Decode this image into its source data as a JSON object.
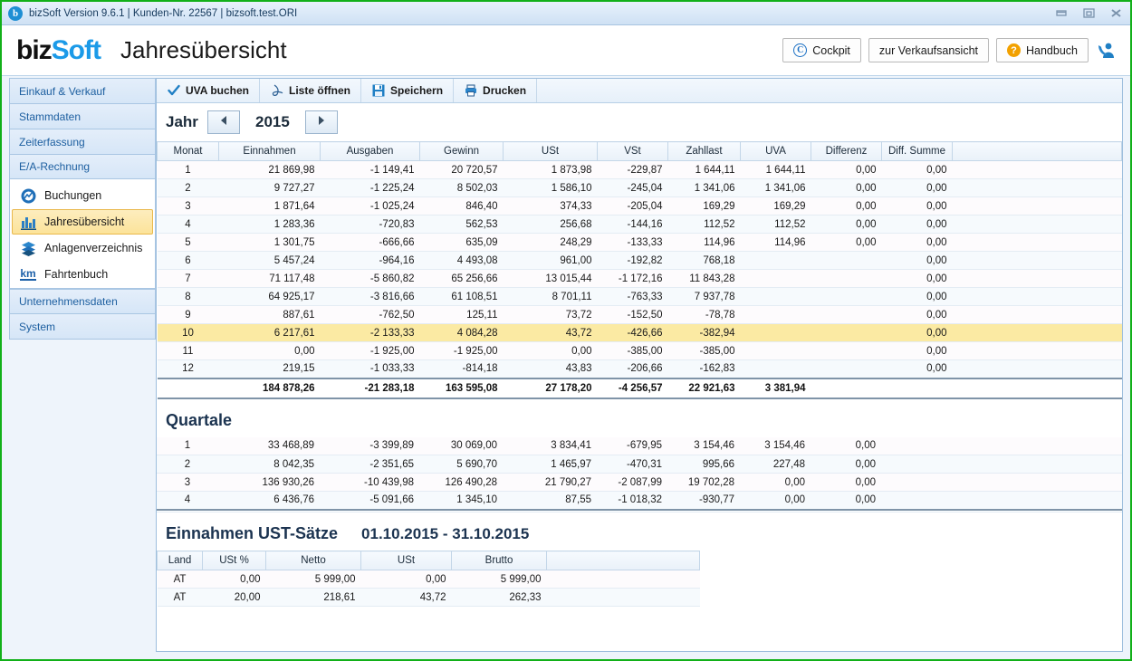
{
  "window": {
    "title": "bizSoft Version 9.6.1 | Kunden-Nr. 22567 | bizsoft.test.ORI",
    "app_icon": "b-circle-icon",
    "controls": [
      "minimize-icon",
      "restore-icon",
      "close-icon"
    ]
  },
  "header": {
    "logo_biz": "biz",
    "logo_soft": "Soft",
    "page_title": "Jahresübersicht",
    "buttons": [
      {
        "label": "Cockpit",
        "icon": "copyright-icon"
      },
      {
        "label": "zur Verkaufsansicht",
        "icon": ""
      },
      {
        "label": "Handbuch",
        "icon": "question-icon"
      }
    ],
    "support_icon": "support-contact-icon"
  },
  "sidebar": {
    "sections": [
      {
        "label": "Einkauf & Verkauf"
      },
      {
        "label": "Stammdaten"
      },
      {
        "label": "Zeiterfassung"
      },
      {
        "label": "E/A-Rechnung"
      }
    ],
    "items": [
      {
        "label": "Buchungen",
        "icon": "chart-circle-icon",
        "active": false
      },
      {
        "label": "Jahresübersicht",
        "icon": "bar-chart-icon",
        "active": true
      },
      {
        "label": "Anlagenverzeichnis",
        "icon": "layers-icon",
        "active": false
      },
      {
        "label": "Fahrtenbuch",
        "icon": "km-icon",
        "active": false
      }
    ],
    "bottom_sections": [
      {
        "label": "Unternehmensdaten"
      },
      {
        "label": "System"
      }
    ]
  },
  "toolbar": {
    "buttons": [
      {
        "label": "UVA buchen",
        "icon": "check-icon"
      },
      {
        "label": "Liste öffnen",
        "icon": "pdf-icon"
      },
      {
        "label": "Speichern",
        "icon": "save-disk-icon"
      },
      {
        "label": "Drucken",
        "icon": "printer-icon"
      }
    ]
  },
  "year_nav": {
    "label": "Jahr",
    "prev_icon": "triangle-left-icon",
    "next_icon": "triangle-right-icon",
    "value": "2015"
  },
  "chart_data": {
    "type": "table",
    "title": "Jahresübersicht 2015",
    "columns": [
      "Monat",
      "Einnahmen",
      "Ausgaben",
      "Gewinn",
      "USt",
      "VSt",
      "Zahllast",
      "UVA",
      "Differenz",
      "Diff. Summe"
    ],
    "monthly_rows": [
      {
        "monat": "1",
        "einnahmen": "21 869,98",
        "ausgaben": "-1 149,41",
        "gewinn": "20 720,57",
        "ust": "1 873,98",
        "vst": "-229,87",
        "zahllast": "1 644,11",
        "uva": "1 644,11",
        "differenz": "0,00",
        "diff_summe": "0,00",
        "highlight": false
      },
      {
        "monat": "2",
        "einnahmen": "9 727,27",
        "ausgaben": "-1 225,24",
        "gewinn": "8 502,03",
        "ust": "1 586,10",
        "vst": "-245,04",
        "zahllast": "1 341,06",
        "uva": "1 341,06",
        "differenz": "0,00",
        "diff_summe": "0,00",
        "highlight": false
      },
      {
        "monat": "3",
        "einnahmen": "1 871,64",
        "ausgaben": "-1 025,24",
        "gewinn": "846,40",
        "ust": "374,33",
        "vst": "-205,04",
        "zahllast": "169,29",
        "uva": "169,29",
        "differenz": "0,00",
        "diff_summe": "0,00",
        "highlight": false
      },
      {
        "monat": "4",
        "einnahmen": "1 283,36",
        "ausgaben": "-720,83",
        "gewinn": "562,53",
        "ust": "256,68",
        "vst": "-144,16",
        "zahllast": "112,52",
        "uva": "112,52",
        "differenz": "0,00",
        "diff_summe": "0,00",
        "highlight": false
      },
      {
        "monat": "5",
        "einnahmen": "1 301,75",
        "ausgaben": "-666,66",
        "gewinn": "635,09",
        "ust": "248,29",
        "vst": "-133,33",
        "zahllast": "114,96",
        "uva": "114,96",
        "differenz": "0,00",
        "diff_summe": "0,00",
        "highlight": false
      },
      {
        "monat": "6",
        "einnahmen": "5 457,24",
        "ausgaben": "-964,16",
        "gewinn": "4 493,08",
        "ust": "961,00",
        "vst": "-192,82",
        "zahllast": "768,18",
        "uva": "",
        "differenz": "",
        "diff_summe": "0,00",
        "highlight": false
      },
      {
        "monat": "7",
        "einnahmen": "71 117,48",
        "ausgaben": "-5 860,82",
        "gewinn": "65 256,66",
        "ust": "13 015,44",
        "vst": "-1 172,16",
        "zahllast": "11 843,28",
        "uva": "",
        "differenz": "",
        "diff_summe": "0,00",
        "highlight": false
      },
      {
        "monat": "8",
        "einnahmen": "64 925,17",
        "ausgaben": "-3 816,66",
        "gewinn": "61 108,51",
        "ust": "8 701,11",
        "vst": "-763,33",
        "zahllast": "7 937,78",
        "uva": "",
        "differenz": "",
        "diff_summe": "0,00",
        "highlight": false
      },
      {
        "monat": "9",
        "einnahmen": "887,61",
        "ausgaben": "-762,50",
        "gewinn": "125,11",
        "ust": "73,72",
        "vst": "-152,50",
        "zahllast": "-78,78",
        "uva": "",
        "differenz": "",
        "diff_summe": "0,00",
        "highlight": false
      },
      {
        "monat": "10",
        "einnahmen": "6 217,61",
        "ausgaben": "-2 133,33",
        "gewinn": "4 084,28",
        "ust": "43,72",
        "vst": "-426,66",
        "zahllast": "-382,94",
        "uva": "",
        "differenz": "",
        "diff_summe": "0,00",
        "highlight": true
      },
      {
        "monat": "11",
        "einnahmen": "0,00",
        "ausgaben": "-1 925,00",
        "gewinn": "-1 925,00",
        "ust": "0,00",
        "vst": "-385,00",
        "zahllast": "-385,00",
        "uva": "",
        "differenz": "",
        "diff_summe": "0,00",
        "highlight": false
      },
      {
        "monat": "12",
        "einnahmen": "219,15",
        "ausgaben": "-1 033,33",
        "gewinn": "-814,18",
        "ust": "43,83",
        "vst": "-206,66",
        "zahllast": "-162,83",
        "uva": "",
        "differenz": "",
        "diff_summe": "0,00",
        "highlight": false
      }
    ],
    "monthly_totals": {
      "monat": "",
      "einnahmen": "184 878,26",
      "ausgaben": "-21 283,18",
      "gewinn": "163 595,08",
      "ust": "27 178,20",
      "vst": "-4 256,57",
      "zahllast": "22 921,63",
      "uva": "3 381,94",
      "differenz": "",
      "diff_summe": ""
    },
    "quarters_title": "Quartale",
    "quarter_rows": [
      {
        "monat": "1",
        "einnahmen": "33 468,89",
        "ausgaben": "-3 399,89",
        "gewinn": "30 069,00",
        "ust": "3 834,41",
        "vst": "-679,95",
        "zahllast": "3 154,46",
        "uva": "3 154,46",
        "differenz": "0,00",
        "diff_summe": ""
      },
      {
        "monat": "2",
        "einnahmen": "8 042,35",
        "ausgaben": "-2 351,65",
        "gewinn": "5 690,70",
        "ust": "1 465,97",
        "vst": "-470,31",
        "zahllast": "995,66",
        "uva": "227,48",
        "differenz": "0,00",
        "diff_summe": ""
      },
      {
        "monat": "3",
        "einnahmen": "136 930,26",
        "ausgaben": "-10 439,98",
        "gewinn": "126 490,28",
        "ust": "21 790,27",
        "vst": "-2 087,99",
        "zahllast": "19 702,28",
        "uva": "0,00",
        "differenz": "0,00",
        "diff_summe": ""
      },
      {
        "monat": "4",
        "einnahmen": "6 436,76",
        "ausgaben": "-5 091,66",
        "gewinn": "1 345,10",
        "ust": "87,55",
        "vst": "-1 018,32",
        "zahllast": "-930,77",
        "uva": "0,00",
        "differenz": "0,00",
        "diff_summe": ""
      }
    ],
    "ust_title": "Einnahmen UST-Sätze",
    "ust_range": "01.10.2015 - 31.10.2015",
    "ust_columns": [
      "Land",
      "USt %",
      "Netto",
      "USt",
      "Brutto"
    ],
    "ust_rows": [
      {
        "land": "AT",
        "ust_pct": "0,00",
        "netto": "5 999,00",
        "ust": "0,00",
        "brutto": "5 999,00"
      },
      {
        "land": "AT",
        "ust_pct": "20,00",
        "netto": "218,61",
        "ust": "43,72",
        "brutto": "262,33"
      }
    ]
  },
  "colors": {
    "positive": "#2e7d32",
    "negative": "#e02020",
    "accent_blue": "#1b9ae8",
    "highlight_row": "#fbeaa3",
    "window_border": "#12b019"
  }
}
